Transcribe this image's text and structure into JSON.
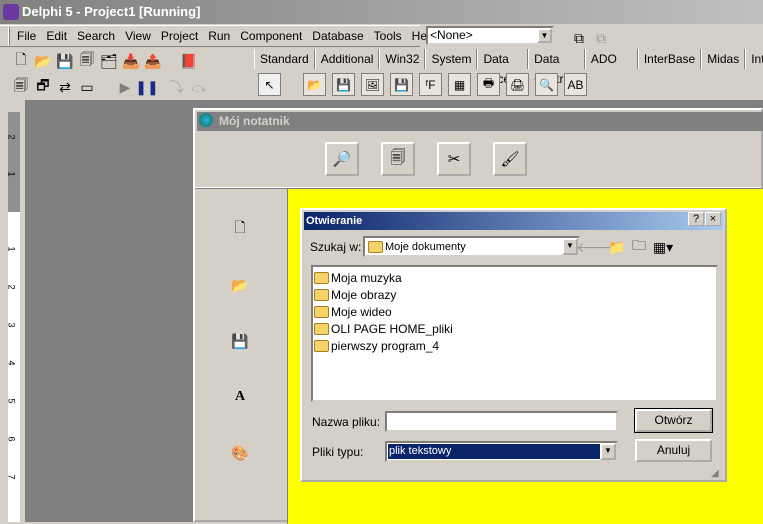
{
  "window": {
    "title": "Delphi 5 - Project1 [Running]"
  },
  "menu": [
    "File",
    "Edit",
    "Search",
    "View",
    "Project",
    "Run",
    "Component",
    "Database",
    "Tools",
    "Help"
  ],
  "component_combo": {
    "value": "<None>"
  },
  "palette_tabs": [
    "Standard",
    "Additional",
    "Win32",
    "System",
    "Data Access",
    "Data Controls",
    "ADO",
    "InterBase",
    "Midas",
    "Int"
  ],
  "ruler_labels": [
    "2",
    "1",
    "1",
    "2",
    "3",
    "4",
    "5",
    "6",
    "7"
  ],
  "form": {
    "title": "Mój notatnik",
    "toolbar_icons": [
      "find-icon",
      "copy-icon",
      "cut-icon",
      "paste-icon"
    ],
    "side_icons": [
      "new-file-icon",
      "open-folder-icon",
      "save-icon",
      "font-icon",
      "color-icon"
    ],
    "background": "#ffff00"
  },
  "dialog": {
    "title": "Otwieranie",
    "help": "?",
    "close": "×",
    "look_in_label": "Szukaj w:",
    "look_in_value": "Moje dokumenty",
    "files": [
      "Moja muzyka",
      "Moje obrazy",
      "Moje wideo",
      "OLI PAGE HOME_pliki",
      "pierwszy program_4"
    ],
    "filename_label": "Nazwa pliku:",
    "filename_value": "",
    "filetype_label": "Pliki typu:",
    "filetype_value": "plik tekstowy",
    "open_button": "Otwórz",
    "cancel_button": "Anuluj"
  }
}
